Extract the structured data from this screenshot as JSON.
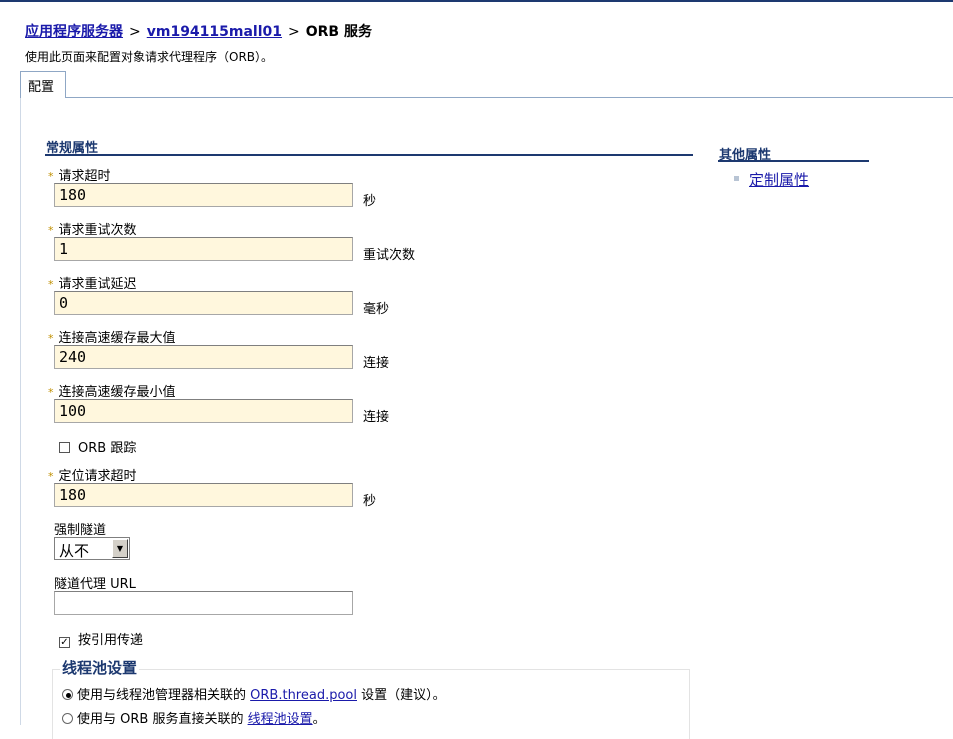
{
  "breadcrumb": {
    "root_link": "应用程序服务器",
    "separator": ">",
    "server_link": "vm194115mall01",
    "current": "ORB 服务"
  },
  "page_description": "使用此页面来配置对象请求代理程序（ORB）。",
  "tabs": [
    {
      "label": "配置",
      "selected": true
    }
  ],
  "general_properties": {
    "title": "常规属性",
    "required_marker": "*",
    "request_timeout": {
      "label": "请求超时",
      "value": "180",
      "unit": "秒"
    },
    "request_retries_count": {
      "label": "请求重试次数",
      "value": "1",
      "unit": "重试次数"
    },
    "request_retries_delay": {
      "label": "请求重试延迟",
      "value": "0",
      "unit": "毫秒"
    },
    "connection_cache_max": {
      "label": "连接高速缓存最大值",
      "value": "240",
      "unit": "连接"
    },
    "connection_cache_min": {
      "label": "连接高速缓存最小值",
      "value": "100",
      "unit": "连接"
    },
    "orb_tracing": {
      "label": "ORB 跟踪",
      "checked": false
    },
    "locate_request_timeout": {
      "label": "定位请求超时",
      "value": "180",
      "unit": "秒"
    },
    "force_tunnel": {
      "label": "强制隧道",
      "selected": "从不"
    },
    "tunnel_agent_url": {
      "label": "隧道代理 URL",
      "value": ""
    },
    "pass_by_reference": {
      "label": "按引用传递",
      "checked": true,
      "check_glyph": "✓"
    }
  },
  "thread_pool": {
    "legend": "线程池设置",
    "option1": {
      "prefix": "使用与线程池管理器相关联的",
      "link": "ORB.thread.pool",
      "suffix": "设置（建议）。",
      "selected": true
    },
    "option2": {
      "prefix": "使用与 ORB 服务直接关联的",
      "link": "线程池设置",
      "suffix": "。",
      "selected": false
    }
  },
  "additional_properties": {
    "title": "其他属性",
    "items": [
      {
        "label": "定制属性"
      }
    ]
  },
  "colors": {
    "heading_blue": "#1d3970",
    "link_blue": "#1a1aaa",
    "required_input_bg": "#fff7dd"
  }
}
